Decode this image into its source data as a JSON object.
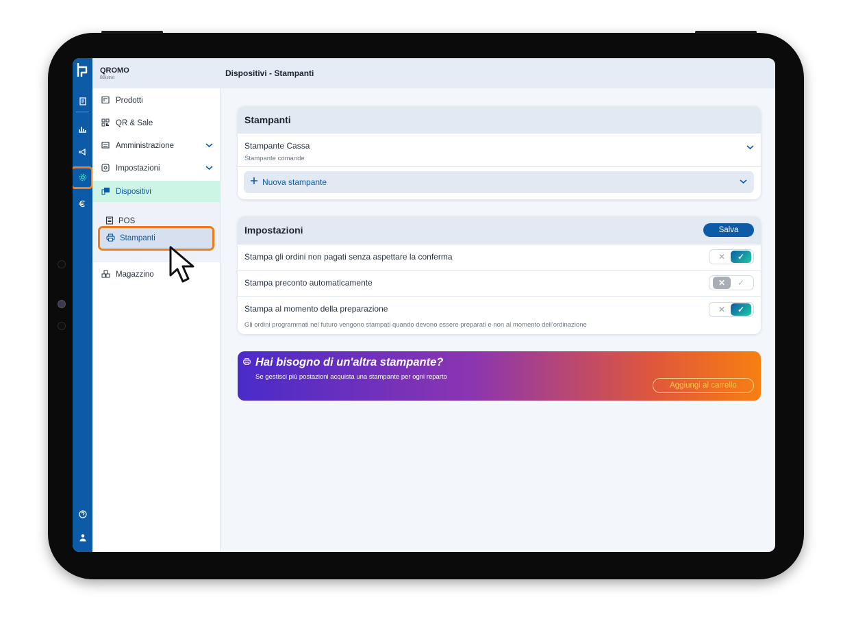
{
  "brand": {
    "name": "QROMO",
    "subtitle": "BBistrot"
  },
  "header": {
    "title": "Dispositivi - Stampanti"
  },
  "rail": {
    "icons": [
      "receipt-icon",
      "chart-icon",
      "megaphone-icon",
      "gear-icon",
      "euro-icon",
      "help-icon",
      "user-icon"
    ]
  },
  "sidebar": {
    "items": [
      {
        "label": "Prodotti",
        "icon": "products-icon"
      },
      {
        "label": "QR & Sale",
        "icon": "qr-icon"
      },
      {
        "label": "Amministrazione",
        "icon": "admin-icon"
      },
      {
        "label": "Impostazioni",
        "icon": "settings-icon"
      },
      {
        "label": "Dispositivi",
        "icon": "devices-icon"
      },
      {
        "label": "Magazzino",
        "icon": "warehouse-icon"
      }
    ],
    "sub_items": [
      {
        "label": "POS",
        "icon": "pos-icon"
      },
      {
        "label": "Stampanti",
        "icon": "printer-icon"
      }
    ]
  },
  "printers": {
    "title": "Stampanti",
    "items": [
      {
        "name": "Stampante Cassa",
        "subtitle": "Stampante comande"
      }
    ],
    "add_label": "Nuova stampante"
  },
  "settings": {
    "title": "Impostazioni",
    "save_label": "Salva",
    "rows": [
      {
        "label": "Stampa gli ordini non pagati senza aspettare la conferma",
        "enabled": true
      },
      {
        "label": "Stampa preconto automaticamente",
        "enabled": false
      },
      {
        "label": "Stampa al momento della preparazione",
        "enabled": true,
        "note": "Gli ordini programmati nel futuro vengono stampati quando devono essere preparati e non al momento dell'ordinazione"
      }
    ]
  },
  "promo": {
    "title": "Hai bisogno di un'altra stampante?",
    "text": "Se gestisci più postazioni acquista una stampante per ogni reparto",
    "button": "Aggiungi al carrello"
  },
  "colors": {
    "accent": "#0d5aa7",
    "highlight": "#f07d1a",
    "active_bg": "#ccf5e6"
  }
}
